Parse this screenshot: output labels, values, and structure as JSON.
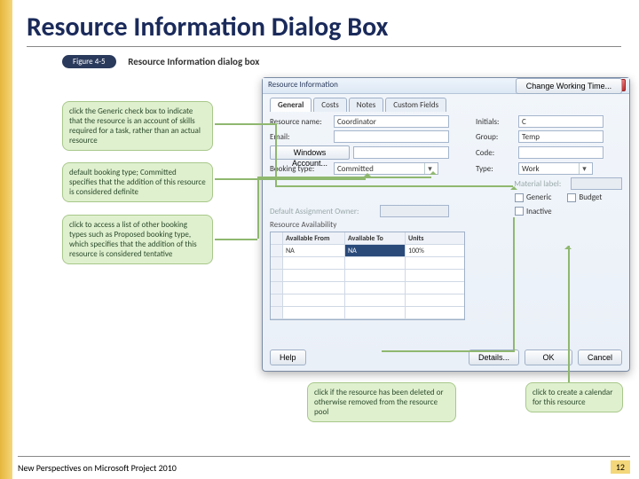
{
  "slide": {
    "title": "Resource Information Dialog Box",
    "footer_left": "New Perspectives on Microsoft Project 2010",
    "page_number": "12"
  },
  "figure": {
    "tag": "Figure 4-5",
    "caption": "Resource Information dialog box"
  },
  "dialog": {
    "title": "Resource Information",
    "close": "✕",
    "tabs": [
      "General",
      "Costs",
      "Notes",
      "Custom Fields"
    ],
    "fields": {
      "resource_name_lbl": "Resource name:",
      "resource_name_val": "Coordinator",
      "initials_lbl": "Initials:",
      "initials_val": "C",
      "email_lbl": "Email:",
      "group_lbl": "Group:",
      "group_val": "Temp",
      "windows_account_btn": "Windows Account...",
      "code_lbl": "Code:",
      "booking_type_lbl": "Booking type:",
      "booking_type_val": "Committed",
      "type_lbl": "Type:",
      "type_val": "Work",
      "material_label_lbl": "Material label:",
      "generic_lbl": "Generic",
      "budget_lbl": "Budget",
      "inactive_lbl": "Inactive",
      "default_assign_lbl": "Default Assignment Owner:",
      "availability_lbl": "Resource Availability",
      "change_working_btn": "Change Working Time..."
    },
    "availability": {
      "headers": [
        "",
        "Available From",
        "Available To",
        "Units"
      ],
      "rows": [
        [
          "",
          "NA",
          "NA",
          "100%"
        ]
      ]
    },
    "buttons": {
      "help": "Help",
      "details": "Details...",
      "ok": "OK",
      "cancel": "Cancel"
    }
  },
  "callouts": {
    "c1": "click the Generic check box to indicate that the resource is an account of skills required for a task, rather than an actual resource",
    "c2": "default booking type; Committed specifies that the addition of this resource is considered definite",
    "c3": "click to access a list of other booking types such as Proposed booking type, which specifies that the addition of this resource is considered tentative",
    "c4": "click if the resource has been deleted or otherwise removed from the resource pool",
    "c5": "click to create a calendar for this resource"
  }
}
